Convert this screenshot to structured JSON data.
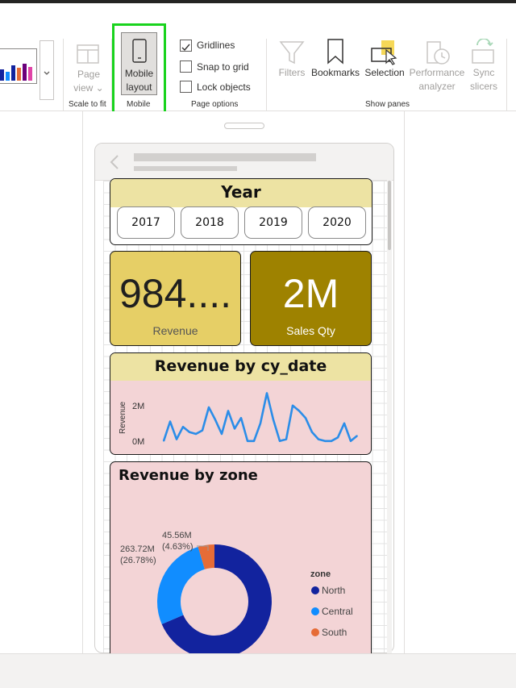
{
  "ribbon": {
    "groups": {
      "scale_to_fit": "Scale to fit",
      "mobile": "Mobile",
      "page_options": "Page options",
      "show_panes": "Show panes"
    },
    "page_view": {
      "line1": "Page",
      "line2": "view"
    },
    "mobile_layout": {
      "line1": "Mobile",
      "line2": "layout"
    },
    "checkboxes": {
      "gridlines": {
        "label": "Gridlines",
        "checked": true
      },
      "snap_to_grid": {
        "label": "Snap to grid",
        "checked": false
      },
      "lock_objects": {
        "label": "Lock objects",
        "checked": false
      }
    },
    "panes": {
      "filters": "Filters",
      "bookmarks": "Bookmarks",
      "selection": "Selection",
      "performance": {
        "line1": "Performance",
        "line2": "analyzer"
      },
      "sync": {
        "line1": "Sync",
        "line2": "slicers"
      }
    }
  },
  "colors": {
    "highlight": "#19d31d",
    "yellow_header": "#ede3a3",
    "kpi_light": "#e6cf66",
    "kpi_dark": "#9e8200",
    "pink_bg": "#f3d4d6",
    "line": "#2b8de8",
    "north": "#12239e",
    "central": "#118dff",
    "south": "#e66c37"
  },
  "report": {
    "year_slicer": {
      "title": "Year",
      "options": [
        "2017",
        "2018",
        "2019",
        "2020"
      ]
    },
    "kpis": [
      {
        "value": "984....",
        "label": "Revenue"
      },
      {
        "value": "2M",
        "label": "Sales Qty"
      }
    ],
    "line_chart": {
      "title": "Revenue by cy_date",
      "ylabel": "Revenue",
      "ticks": [
        "2M",
        "0M"
      ]
    },
    "donut": {
      "title": "Revenue by zone",
      "legend_title": "zone",
      "labels": [
        {
          "value": "45.56M",
          "pct": "(4.63%)"
        },
        {
          "value": "263.72M",
          "pct": "(26.78%)"
        }
      ],
      "legend": [
        "North",
        "Central",
        "South"
      ]
    }
  },
  "chart_data": [
    {
      "type": "line",
      "title": "Revenue by cy_date",
      "ylabel": "Revenue",
      "ylim": [
        0,
        3
      ],
      "yticks": [
        "0M",
        "2M"
      ],
      "series": [
        {
          "values": [
            0.1,
            1.2,
            0.2,
            0.9,
            0.6,
            0.5,
            0.7,
            2.0,
            1.3,
            0.5,
            1.8,
            0.8,
            1.4,
            0.1,
            0.1,
            1.1,
            2.8,
            1.3,
            0.1,
            0.2,
            2.1,
            1.8,
            1.4,
            0.6,
            0.2,
            0.1,
            0.1,
            0.3,
            1.1,
            0.1,
            0.4
          ]
        }
      ]
    },
    {
      "type": "pie",
      "title": "Revenue by zone",
      "categories": [
        "North",
        "Central",
        "South"
      ],
      "values": [
        68.59,
        26.78,
        4.63
      ]
    }
  ]
}
